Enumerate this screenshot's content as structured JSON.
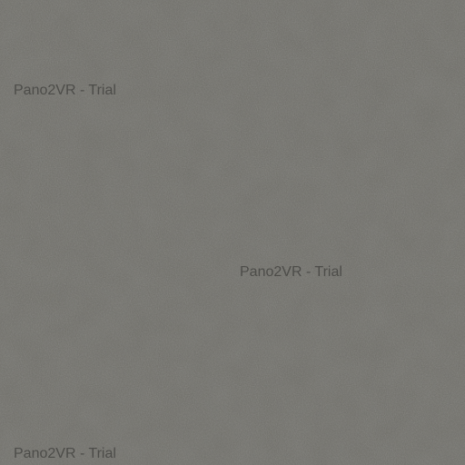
{
  "surface": {
    "description_color_base": "#6b6a64",
    "speckle_light": "#8a8780",
    "speckle_dark": "#4f4e4a"
  },
  "watermarks": [
    {
      "text": "Pano2VR - Trial"
    },
    {
      "text": "Pano2VR - Trial"
    },
    {
      "text": "Pano2VR - Trial"
    }
  ]
}
